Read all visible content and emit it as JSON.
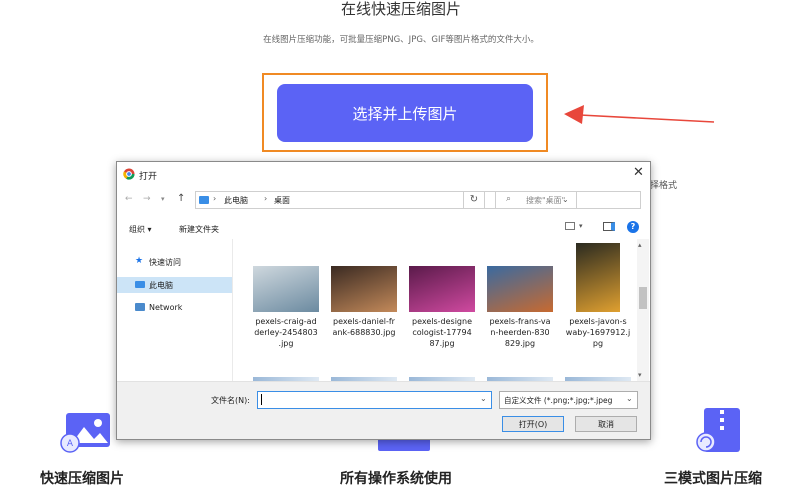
{
  "page": {
    "title": "在线快速压缩图片",
    "subtitle": "在线图片压缩功能，可批量压缩PNG、JPG、GIF等图片格式的文件大小。",
    "upload_button": "选择并上传图片",
    "side_text": "择格式",
    "features": [
      {
        "label": "快速压缩图片",
        "icon": "image-icon"
      },
      {
        "label": "所有操作系统使用",
        "icon": "device-icon"
      },
      {
        "label": "三模式图片压缩",
        "icon": "zip-icon"
      }
    ],
    "arrow_color": "#e8473b",
    "accent": "#5b63f5",
    "frame_color": "#f08a24"
  },
  "dialog": {
    "title": "打开",
    "path": [
      "此电脑",
      "桌面"
    ],
    "search_placeholder": "搜索\"桌面\"",
    "toolbar": {
      "organize": "组织 ▾",
      "new_folder": "新建文件夹"
    },
    "nav": [
      {
        "label": "快速访问",
        "icon": "star-icon"
      },
      {
        "label": "此电脑",
        "icon": "computer-icon"
      },
      {
        "label": "Network",
        "icon": "network-icon"
      }
    ],
    "files": [
      {
        "name": "pexels-craig-ad\nderley-2454803\n.jpg",
        "colors": [
          "#cfd8de",
          "#6b8aa0"
        ]
      },
      {
        "name": "pexels-daniel-fr\nank-688830.jpg",
        "colors": [
          "#3a2a22",
          "#c48a5a"
        ]
      },
      {
        "name": "pexels-designe\ncologist-17794\n87.jpg",
        "colors": [
          "#5a1a4a",
          "#d04aa0"
        ]
      },
      {
        "name": "pexels-frans-va\nn-heerden-830\n829.jpg",
        "colors": [
          "#3a6aa0",
          "#c86a30"
        ]
      },
      {
        "name": "pexels-javon-s\nwaby-1697912.j\npg",
        "colors": [
          "#2a2a20",
          "#e0a030"
        ]
      }
    ],
    "filename_label": "文件名(N):",
    "filename_value": "",
    "filetype": "自定义文件 (*.png;*.jpg;*.jpeg",
    "open_button": "打开(O)",
    "cancel_button": "取消"
  }
}
